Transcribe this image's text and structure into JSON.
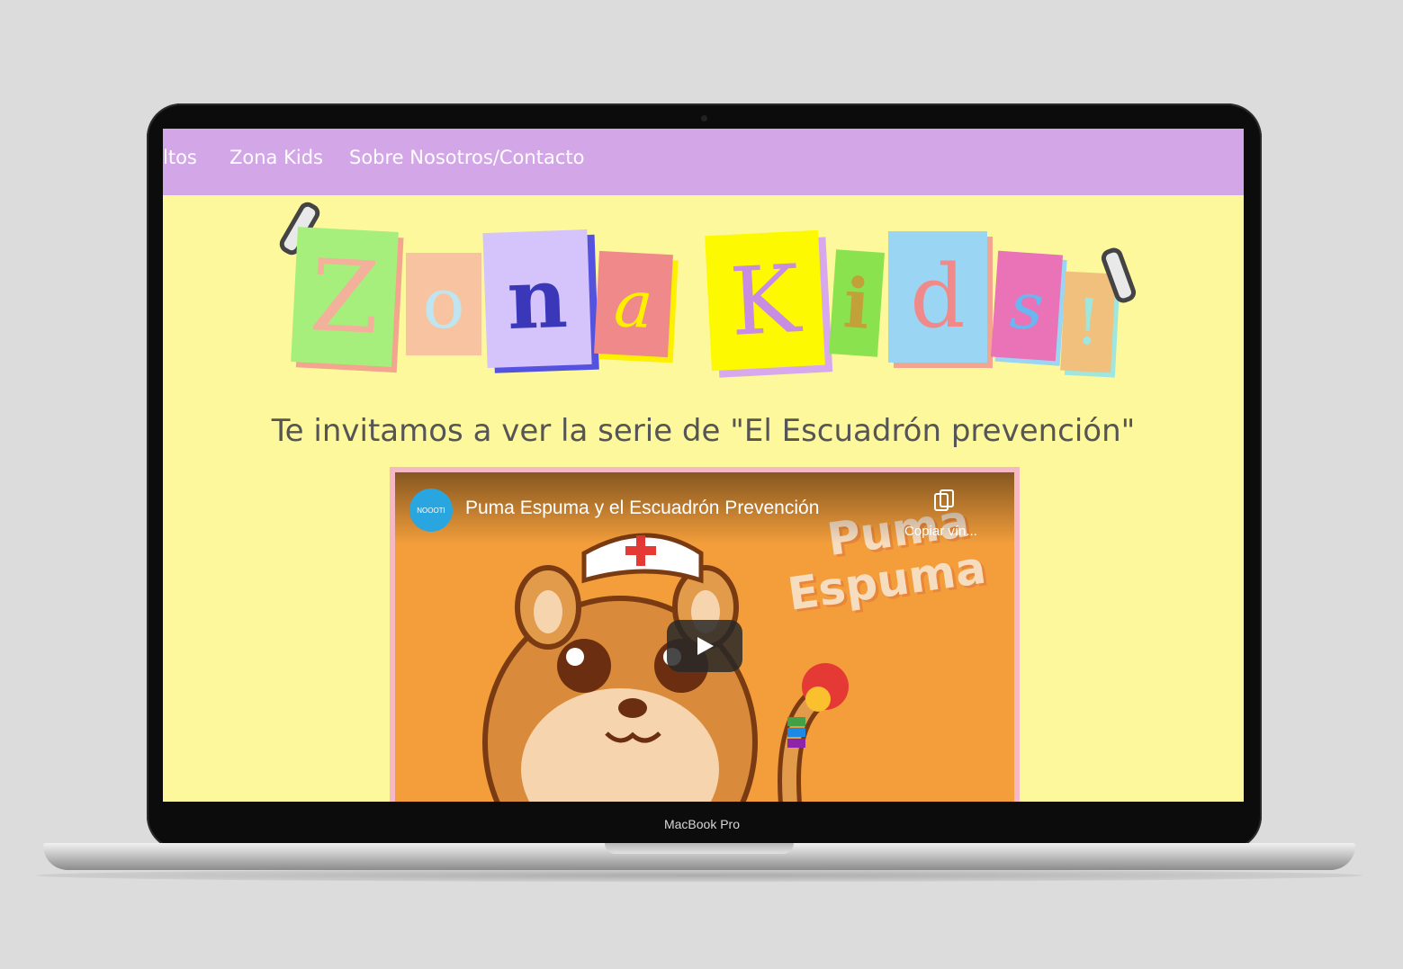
{
  "nav": {
    "items": [
      {
        "label": "ltos"
      },
      {
        "label": "Zona Kids"
      },
      {
        "label": "Sobre Nosotros/Contacto"
      }
    ]
  },
  "logo": {
    "letters": [
      "Z",
      "o",
      "n",
      "a",
      "K",
      "i",
      "d",
      "s",
      "!"
    ]
  },
  "main": {
    "heading": "Te invitamos a ver la serie de \"El Escuadrón prevención\""
  },
  "video": {
    "channel_badge": "NOOOTI",
    "title": "Puma Espuma y el Escuadrón Prevención",
    "copy_label": "Copiar vín...",
    "thumbnail_text_1": "Puma",
    "thumbnail_text_2": "Espuma"
  },
  "device": {
    "brand_label": "MacBook Pro"
  },
  "colors": {
    "nav_bg": "#d3a6e8",
    "page_bg": "#fdf89c",
    "video_bg": "#f39e3b",
    "frame": "#f7b8c6"
  }
}
